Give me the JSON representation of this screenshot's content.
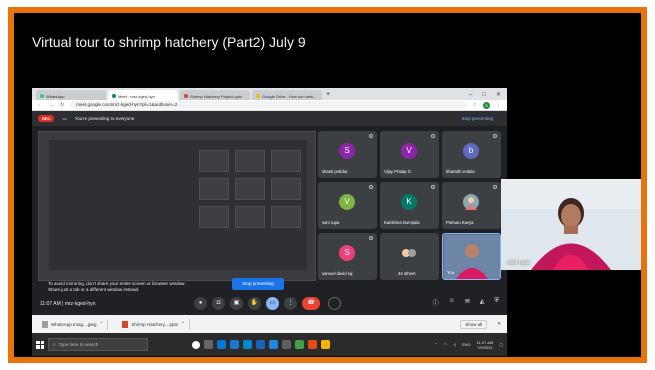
{
  "slide_title": "Virtual tour to shrimp hatchery (Part2) July 9",
  "browser": {
    "tabs": [
      "WhatsApp",
      "Meet - mrz-kged-hyn",
      "Shrimp Hatchery Project.pptx",
      "Google Drive - How suri web..."
    ],
    "url": "meet.google.com/mrz-kged-hyn?pli=1&authuser=2",
    "profile_initial": "S"
  },
  "meet": {
    "rec_label": "REC",
    "presenting_text": "You're presenting to everyone",
    "stop_presenting_link": "Stop presenting",
    "mirror_warning_line1": "To avoid mirroring, don't share your entire screen or browser window.",
    "mirror_warning_line2": "Share just a tab or a different window instead.",
    "stop_presenting_button": "Stop presenting",
    "ignore_button": "Ignore",
    "meeting_info": "11:07 AM | mrz-kged-hyn",
    "participants": [
      {
        "name": "shanti prabha",
        "initial": "S",
        "color": "#8e24aa"
      },
      {
        "name": "Vijay Pratap G",
        "initial": "V",
        "color": "#8e24aa"
      },
      {
        "name": "bharathi vedula",
        "initial": "b",
        "color": "#5c6bc0"
      },
      {
        "name": "vani rupa",
        "initial": "V",
        "color": "#7cb342"
      },
      {
        "name": "Karishma Dumpala",
        "initial": "K",
        "color": "#00796b"
      },
      {
        "name": "Potnuru Kavya",
        "initial": "",
        "color": "#90a4ae"
      },
      {
        "name": "samuel david raj",
        "initial": "S",
        "color": "#ec407a"
      },
      {
        "name": "34 others",
        "initial": "",
        "color": "#3c4043"
      },
      {
        "name": "You",
        "initial": "",
        "color": "#5a6e8c"
      }
    ]
  },
  "downloads": {
    "items": [
      "WhatsApp Imag....jpeg",
      "Shrimp Hatchery....pptx"
    ],
    "show_all": "Show all"
  },
  "taskbar": {
    "search_placeholder": "Type here to search",
    "time": "11:07 AM",
    "date": "7/9/2021",
    "lang": "ENG"
  },
  "camera": {
    "name": "vani rupa"
  }
}
